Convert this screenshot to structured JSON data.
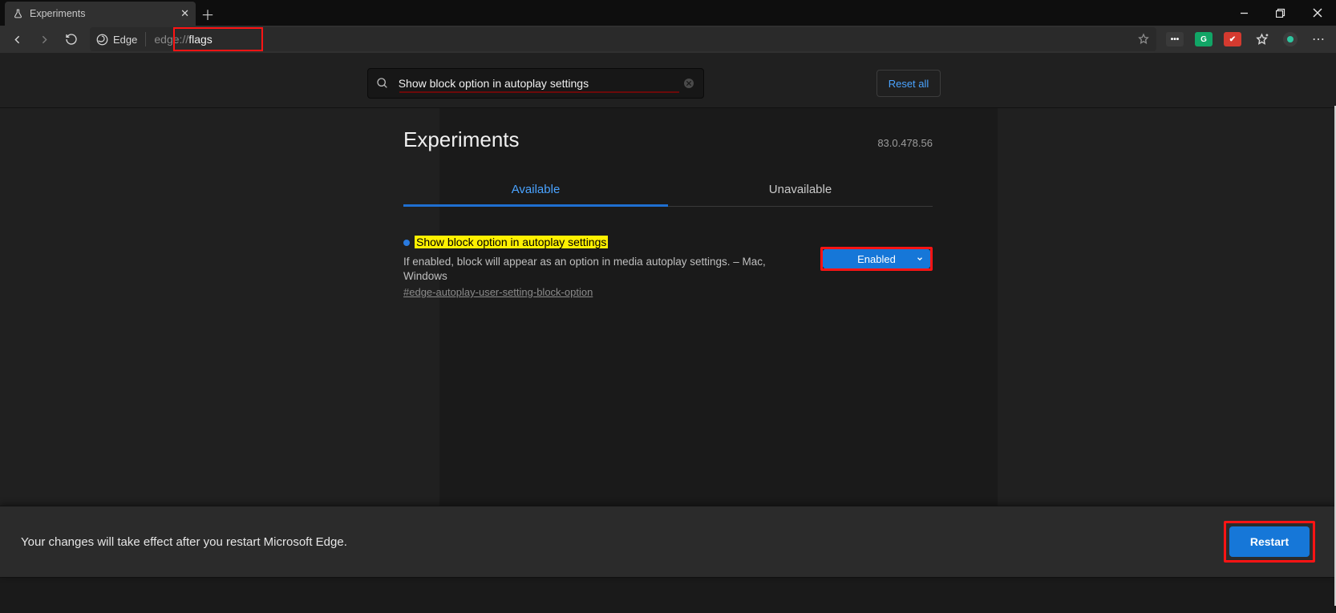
{
  "browser": {
    "tab_title": "Experiments",
    "address": {
      "scheme": "edge://",
      "path": "flags",
      "identity_label": "Edge"
    }
  },
  "toolbar_ext": {
    "g": "G"
  },
  "search": {
    "value": "Show block option in autoplay settings",
    "reset_label": "Reset all"
  },
  "header": {
    "title": "Experiments",
    "version": "83.0.478.56"
  },
  "tabs": {
    "available": "Available",
    "unavailable": "Unavailable"
  },
  "flag": {
    "title": "Show block option in autoplay settings",
    "description": "If enabled, block will appear as an option in media autoplay settings. – Mac, Windows",
    "anchor": "#edge-autoplay-user-setting-block-option",
    "select_value": "Enabled"
  },
  "banner": {
    "message": "Your changes will take effect after you restart Microsoft Edge.",
    "button": "Restart"
  }
}
